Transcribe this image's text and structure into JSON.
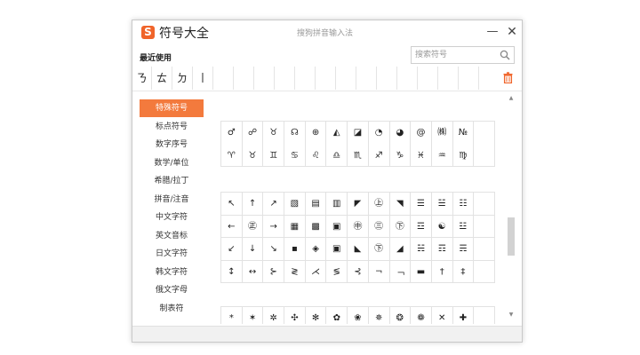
{
  "window": {
    "title": "符号大全",
    "subtitle": "搜狗拼音输入法",
    "logo_glyph": "S",
    "minimize_glyph": "—",
    "close_glyph": "✕",
    "accent_color": "#f37a3d"
  },
  "recent": {
    "label": "最近使用",
    "symbols": [
      "ㄋ",
      "ㄊ",
      "ㄉ",
      "丨",
      "",
      "",
      "",
      "",
      "",
      "",
      "",
      "",
      "",
      "",
      "",
      "",
      ""
    ]
  },
  "search": {
    "placeholder": "搜索符号",
    "value": ""
  },
  "sidebar": {
    "items": [
      {
        "label": "特殊符号",
        "active": true
      },
      {
        "label": "标点符号",
        "active": false
      },
      {
        "label": "数字序号",
        "active": false
      },
      {
        "label": "数学/单位",
        "active": false
      },
      {
        "label": "希腊/拉丁",
        "active": false
      },
      {
        "label": "拼音/注音",
        "active": false
      },
      {
        "label": "中文字符",
        "active": false
      },
      {
        "label": "英文音标",
        "active": false
      },
      {
        "label": "日文字符",
        "active": false
      },
      {
        "label": "韩文字符",
        "active": false
      },
      {
        "label": "俄文字母",
        "active": false
      },
      {
        "label": "制表符",
        "active": false
      }
    ]
  },
  "sections": [
    {
      "symbols": [
        "♂",
        "☍",
        "♉",
        "☊",
        "⊕",
        "◭",
        "◪",
        "◔",
        "◕",
        "@",
        "㈱",
        "№",
        "",
        "♈",
        "♉",
        "♊",
        "♋",
        "♌",
        "♎",
        "♏",
        "♐",
        "♑",
        "♓",
        "♒",
        "♍",
        ""
      ]
    },
    {
      "symbols": [
        "↖",
        "↑",
        "↗",
        "▧",
        "▤",
        "▥",
        "◤",
        "㊤",
        "◥",
        "☰",
        "☱",
        "☷",
        "",
        "←",
        "㊣",
        "→",
        "▦",
        "▩",
        "▣",
        "㊥",
        "㊂",
        "㊦",
        "☲",
        "☯",
        "☳",
        "",
        "↙",
        "↓",
        "↘",
        "▪",
        "◈",
        "▣",
        "◣",
        "㊦",
        "◢",
        "☵",
        "☶",
        "☴",
        "",
        "↕",
        "↔",
        "⊱",
        "≷",
        "⋌",
        "≶",
        "⊰",
        "¬",
        "﹁",
        "▬",
        "†",
        "‡",
        ""
      ]
    },
    {
      "symbols": [
        "*",
        "✶",
        "✲",
        "✣",
        "✻",
        "✿",
        "❀",
        "✵",
        "❂",
        "❁",
        "✕",
        "✚",
        "",
        "",
        "",
        "",
        "",
        "",
        "·",
        "",
        "",
        "",
        "",
        "",
        "",
        ""
      ]
    }
  ]
}
